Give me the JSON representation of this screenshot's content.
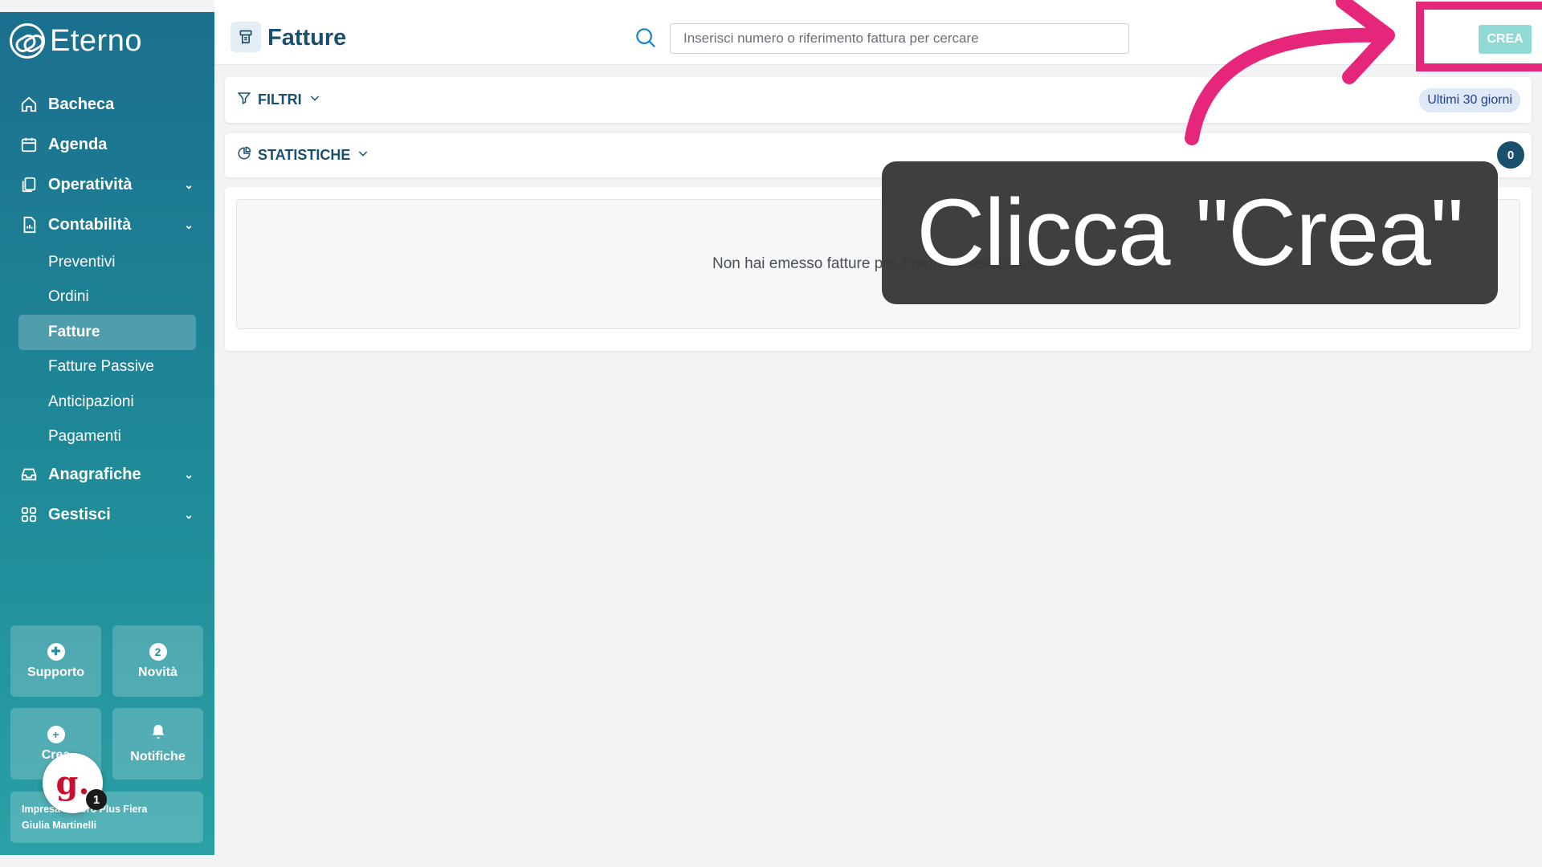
{
  "app": {
    "name": "Eterno"
  },
  "sidebar": {
    "items": [
      {
        "label": "Bacheca",
        "icon": "home-icon"
      },
      {
        "label": "Agenda",
        "icon": "calendar-icon"
      },
      {
        "label": "Operatività",
        "icon": "clipboard-icon"
      },
      {
        "label": "Contabilità",
        "icon": "document-chart-icon"
      }
    ],
    "sub_items": [
      "Preventivi",
      "Ordini",
      "Fatture",
      "Fatture Passive",
      "Anticipazioni",
      "Pagamenti"
    ],
    "active_sub_item": "Fatture",
    "items_after": [
      {
        "label": "Anagrafiche",
        "icon": "inbox-icon"
      },
      {
        "label": "Gestisci",
        "icon": "grid-icon"
      }
    ],
    "tiles": {
      "support": "Supporto",
      "news": "Novità",
      "news_count": "2",
      "create": "Crea",
      "notifications": "Notifiche"
    },
    "company": {
      "line1": "Impresa Lavoro Plus Fiera",
      "line2": "Giulia Martinelli"
    },
    "chat_badge": "1"
  },
  "header": {
    "title": "Fatture",
    "search_placeholder": "Inserisci numero o riferimento fattura per cercare",
    "create_button": "CREA"
  },
  "filters": {
    "label": "FILTRI",
    "period": "Ultimi 30 giorni"
  },
  "stats": {
    "label": "STATISTICHE",
    "count": "0"
  },
  "empty_message": "Non hai emesso fatture per il periodo selezionato",
  "overlay": {
    "callout": "Clicca \"Crea\""
  },
  "colors": {
    "accent": "#1b4f6e",
    "highlight": "#e6267a",
    "create_button": "#90d9d4"
  }
}
